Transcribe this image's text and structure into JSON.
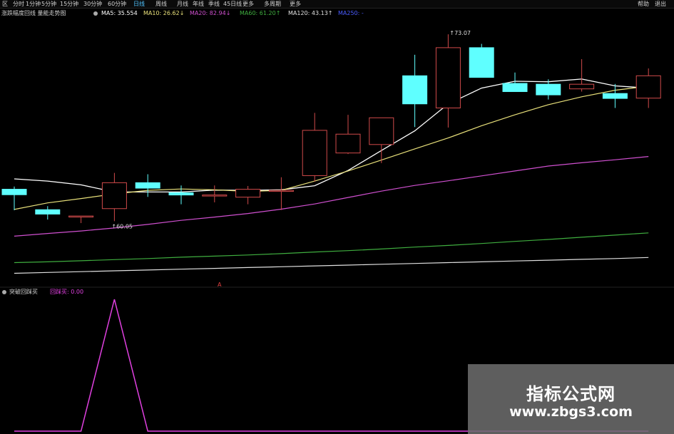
{
  "toolbar": {
    "tabs": [
      "分时",
      "1分钟",
      "5分钟",
      "15分钟",
      "30分钟",
      "60分钟",
      "日线",
      "周线",
      "月线",
      "年线",
      "季线",
      "45日线",
      "更多"
    ],
    "active_tab": "日线",
    "extra_left": [
      "区"
    ],
    "menu": [
      "多周期",
      "更多"
    ],
    "right": [
      "帮助",
      "退出"
    ]
  },
  "main_info": {
    "indicator_name": "涨跌幅度回线 量能走势图",
    "ma5": "MA5: 35.554",
    "ma10": "MA10: 26.62↓",
    "ma20": "MA20: 82.94↓",
    "ma60": "MA60: 61.20↑",
    "ma120": "MA120: 43.13↑",
    "ma250": "MA250: -"
  },
  "sub_info": {
    "indicator_name": "突破回踩买",
    "value_label": "回踩买: 0.00"
  },
  "watermark": {
    "logo": "指标公式网",
    "url": "www.zbgs3.com"
  },
  "colors": {
    "up": "#d04a4a",
    "down": "#5fffff",
    "ma5": "#ffffff",
    "ma10": "#e8e07a",
    "ma20": "#d050d0",
    "ma60": "#3fae3f",
    "ma120": "#e0e0e0",
    "sub": "#e040e0",
    "active_tab": "#4fc3ff"
  },
  "chart_data": [
    {
      "type": "candlestick",
      "title": "",
      "ylim": [
        25.5,
        34.8
      ],
      "high_label": "↑73.07",
      "low_label": "↑60.05",
      "marker_label": "A",
      "candles": [
        {
          "o": 28.62,
          "h": 28.72,
          "c": 28.42,
          "l": 27.85
        },
        {
          "o": 27.87,
          "h": 28.0,
          "c": 27.71,
          "l": 27.51
        },
        {
          "o": 27.64,
          "h": 27.64,
          "c": 27.64,
          "l": 27.38
        },
        {
          "o": 27.91,
          "h": 29.22,
          "c": 28.86,
          "l": 27.45
        },
        {
          "o": 28.86,
          "h": 29.17,
          "c": 28.66,
          "l": 28.34
        },
        {
          "o": 28.49,
          "h": 28.76,
          "c": 28.41,
          "l": 28.07
        },
        {
          "o": 28.41,
          "h": 28.76,
          "c": 28.41,
          "l": 28.14
        },
        {
          "o": 28.33,
          "h": 28.74,
          "c": 28.62,
          "l": 28.07
        },
        {
          "o": 28.58,
          "h": 29.06,
          "c": 28.58,
          "l": 27.86
        },
        {
          "o": 29.12,
          "h": 31.42,
          "c": 30.78,
          "l": 28.9
        },
        {
          "o": 29.95,
          "h": 31.35,
          "c": 30.64,
          "l": 29.91
        },
        {
          "o": 30.26,
          "h": 31.22,
          "c": 31.24,
          "l": 29.58
        },
        {
          "o": 32.78,
          "h": 33.55,
          "c": 31.75,
          "l": 30.9
        },
        {
          "o": 31.6,
          "h": 34.3,
          "c": 33.81,
          "l": 30.88
        },
        {
          "o": 33.81,
          "h": 33.95,
          "c": 32.72,
          "l": 32.72
        },
        {
          "o": 32.5,
          "h": 32.9,
          "c": 32.2,
          "l": 32.2
        },
        {
          "o": 32.47,
          "h": 32.65,
          "c": 32.08,
          "l": 31.91
        },
        {
          "o": 32.3,
          "h": 33.39,
          "c": 32.47,
          "l": 32.2
        },
        {
          "o": 32.13,
          "h": 32.48,
          "c": 31.95,
          "l": 31.6
        },
        {
          "o": 31.96,
          "h": 33.05,
          "c": 32.78,
          "l": 31.6
        }
      ],
      "series": [
        {
          "name": "MA5",
          "values": [
            29.0,
            28.92,
            28.78,
            28.52,
            28.52,
            28.52,
            28.59,
            28.58,
            28.6,
            28.75,
            29.31,
            30.04,
            30.76,
            31.75,
            32.33,
            32.58,
            32.56,
            32.66,
            32.41,
            32.33
          ]
        },
        {
          "name": "MA10",
          "values": [
            27.88,
            28.12,
            28.28,
            28.45,
            28.58,
            28.63,
            28.6,
            28.54,
            28.58,
            28.92,
            29.29,
            29.69,
            30.1,
            30.5,
            30.95,
            31.35,
            31.72,
            32.01,
            32.25,
            32.4
          ]
        },
        {
          "name": "MA20",
          "values": [
            26.9,
            27.0,
            27.09,
            27.2,
            27.33,
            27.48,
            27.6,
            27.73,
            27.89,
            28.08,
            28.32,
            28.55,
            28.76,
            28.93,
            29.11,
            29.29,
            29.47,
            29.59,
            29.7,
            29.82
          ]
        },
        {
          "name": "MA60",
          "values": [
            25.93,
            25.96,
            26.0,
            26.04,
            26.08,
            26.13,
            26.17,
            26.21,
            26.26,
            26.32,
            26.37,
            26.43,
            26.5,
            26.56,
            26.63,
            26.71,
            26.78,
            26.86,
            26.94,
            27.02
          ]
        },
        {
          "name": "MA120",
          "values": [
            25.54,
            25.57,
            25.6,
            25.63,
            25.66,
            25.69,
            25.72,
            25.75,
            25.78,
            25.81,
            25.84,
            25.87,
            25.9,
            25.93,
            25.96,
            25.99,
            26.02,
            26.05,
            26.08,
            26.12
          ]
        }
      ]
    },
    {
      "type": "line",
      "title": "",
      "ylim": [
        0,
        1
      ],
      "series": [
        {
          "name": "回踩买",
          "values": [
            0,
            0,
            0,
            1,
            0,
            0,
            0,
            0,
            0,
            0,
            0,
            0,
            0,
            0,
            0,
            0,
            0,
            0,
            0,
            0
          ]
        }
      ]
    }
  ]
}
